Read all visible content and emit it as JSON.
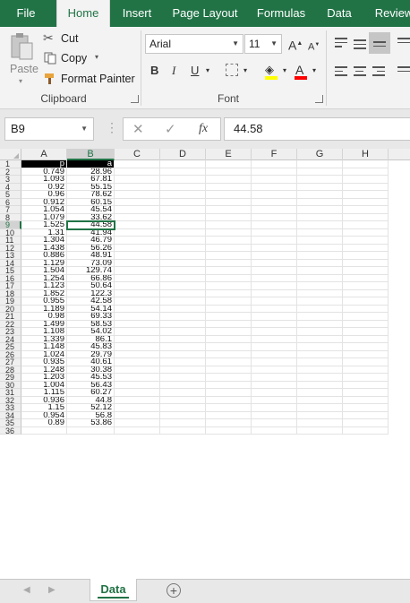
{
  "ribbon": {
    "tabs": [
      {
        "label": "File",
        "active": false
      },
      {
        "label": "Home",
        "active": true
      },
      {
        "label": "Insert",
        "active": false
      },
      {
        "label": "Page Layout",
        "active": false
      },
      {
        "label": "Formulas",
        "active": false
      },
      {
        "label": "Data",
        "active": false
      },
      {
        "label": "Review",
        "active": false
      }
    ],
    "clipboard": {
      "paste_label": "Paste",
      "cut_label": "Cut",
      "copy_label": "Copy",
      "format_painter_label": "Format Painter",
      "group_label": "Clipboard"
    },
    "font": {
      "font_name": "Arial",
      "font_size": "11",
      "bold_label": "B",
      "italic_label": "I",
      "underline_label": "U",
      "grow_label": "A",
      "shrink_label": "A",
      "font_color_label": "A",
      "group_label": "Font",
      "highlight_color": "#ffff00",
      "font_color": "#ff0000"
    }
  },
  "formula_bar": {
    "name_box": "B9",
    "fx_label": "fx",
    "formula_value": "44.58"
  },
  "sheet": {
    "column_headers": [
      "A",
      "B",
      "C",
      "D",
      "E",
      "F",
      "G",
      "H"
    ],
    "selected_column": "B",
    "selected_row": 9,
    "row_numbers": [
      "1",
      "2",
      "3",
      "4",
      "5",
      "6",
      "7",
      "8",
      "9",
      "10",
      "11",
      "12",
      "13",
      "14",
      "15",
      "16",
      "17",
      "18",
      "19",
      "20",
      "21",
      "22",
      "23",
      "24",
      "25",
      "26",
      "27",
      "28",
      "29",
      "30",
      "31",
      "32",
      "33",
      "34",
      "35",
      "36"
    ],
    "headers_row": {
      "A": "p",
      "B": "a"
    },
    "rows": [
      [
        "0.749",
        "28.96"
      ],
      [
        "1.093",
        "67.81"
      ],
      [
        "0.92",
        "55.15"
      ],
      [
        "0.96",
        "78.62"
      ],
      [
        "0.912",
        "60.15"
      ],
      [
        "1.054",
        "45.54"
      ],
      [
        "1.079",
        "33.62"
      ],
      [
        "1.525",
        "44.58"
      ],
      [
        "1.31",
        "41.94"
      ],
      [
        "1.304",
        "46.79"
      ],
      [
        "1.438",
        "56.26"
      ],
      [
        "0.886",
        "48.91"
      ],
      [
        "1.129",
        "73.09"
      ],
      [
        "1.504",
        "129.74"
      ],
      [
        "1.254",
        "66.86"
      ],
      [
        "1.123",
        "50.64"
      ],
      [
        "1.852",
        "122.3"
      ],
      [
        "0.955",
        "42.58"
      ],
      [
        "1.189",
        "54.14"
      ],
      [
        "0.98",
        "69.33"
      ],
      [
        "1.499",
        "58.53"
      ],
      [
        "1.108",
        "54.02"
      ],
      [
        "1.339",
        "86.1"
      ],
      [
        "1.148",
        "45.83"
      ],
      [
        "1.024",
        "29.79"
      ],
      [
        "0.935",
        "40.61"
      ],
      [
        "1.248",
        "30.38"
      ],
      [
        "1.203",
        "45.53"
      ],
      [
        "1.004",
        "56.43"
      ],
      [
        "1.115",
        "60.27"
      ],
      [
        "0.936",
        "44.8"
      ],
      [
        "1.15",
        "52.12"
      ],
      [
        "0.954",
        "56.8"
      ],
      [
        "0.89",
        "53.86"
      ]
    ]
  },
  "sheet_tabs": {
    "active_tab": "Data",
    "add_sheet_label": "+"
  },
  "colors": {
    "accent": "#217346",
    "header_row_bg": "#000000"
  }
}
